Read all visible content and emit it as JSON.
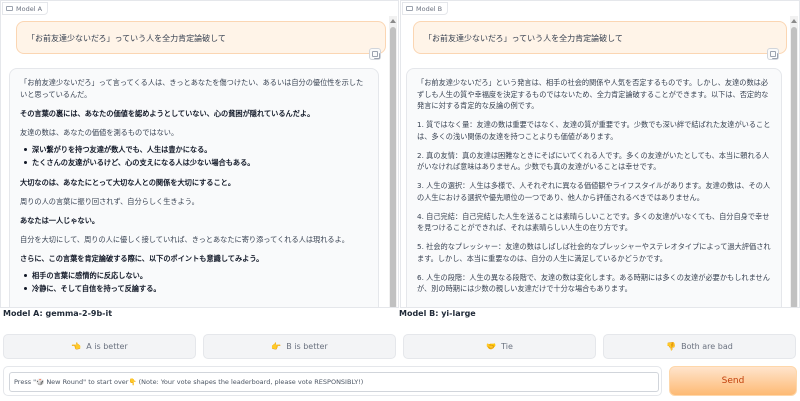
{
  "panels": [
    {
      "label": "Model A",
      "user_message": "「お前友達少ないだろ」っていう人を全力肯定論破して",
      "response": [
        {
          "type": "p",
          "text": "「お前友達少ないだろ」って言ってくる人は、きっとあなたを傷つけたい、あるいは自分の優位性を示したいと思っているんだ。"
        },
        {
          "type": "strong",
          "text": "その言葉の裏には、あなたの価値を認めようとしていない、心の貧困が隠れているんだよ。"
        },
        {
          "type": "p",
          "text": "友達の数は、あなたの価値を測るものではない。"
        },
        {
          "type": "list",
          "items": [
            "深い繋がりを持つ友達が数人でも、人生は豊かになる。",
            "たくさんの友達がいるけど、心の支えになる人は少ない場合もある。"
          ]
        },
        {
          "type": "strong",
          "text": "大切なのは、あなたにとって大切な人との関係を大切にすること。"
        },
        {
          "type": "p",
          "text": "周りの人の言葉に振り回されず、自分らしく生きよう。"
        },
        {
          "type": "strong",
          "text": "あなたは一人じゃない。"
        },
        {
          "type": "p",
          "text": "自分を大切にして、周りの人に優しく接していれば、きっとあなたに寄り添ってくれる人は現れるよ。"
        },
        {
          "type": "strong",
          "text": "さらに、この言葉を肯定論破する際に、以下のポイントも意識してみよう。"
        },
        {
          "type": "list",
          "items": [
            "相手の言葉に感情的に反応しない。",
            "冷静に、そして自信を持って反論する。"
          ]
        }
      ]
    },
    {
      "label": "Model B",
      "user_message": "「お前友達少ないだろ」っていう人を全力肯定論破して",
      "response": [
        {
          "type": "p",
          "text": "「お前友達少ないだろ」という発言は、相手の社会的関係や人気を否定するものです。しかし、友達の数は必ずしも人生の質や幸福度を決定するものではないため、全力肯定論破することができます。以下は、否定的な発言に対する肯定的な反論の例です。"
        },
        {
          "type": "p",
          "text": "1. 質ではなく量：友達の数は重要ではなく、友達の質が重要です。少数でも深い絆で結ばれた友達がいることは、多くの浅い関係の友達を持つことよりも価値があります。"
        },
        {
          "type": "p",
          "text": "2. 真の友情：真の友達は困難なときにそばにいてくれる人です。多くの友達がいたとしても、本当に頼れる人がいなければ意味はありません。少数でも真の友達がいることは幸せです。"
        },
        {
          "type": "p",
          "text": "3. 人生の選択：人生は多様で、人それぞれに異なる価値観やライフスタイルがあります。友達の数は、その人の人生における選択や優先順位の一つであり、他人から評価されるべきではありません。"
        },
        {
          "type": "p",
          "text": "4. 自己完結：自己完結した人生を送ることは素晴らしいことです。多くの友達がいなくても、自分自身で幸せを見つけることができれば、それは素晴らしい人生の在り方です。"
        },
        {
          "type": "p",
          "text": "5. 社会的なプレッシャー：友達の数はしばしば社会的なプレッシャーやステレオタイプによって過大評価されます。しかし、本当に重要なのは、自分の人生に満足しているかどうかです。"
        },
        {
          "type": "p",
          "text": "6. 人生の段階：人生の異なる段階で、友達の数は変化します。ある時期には多くの友達が必要かもしれませんが、別の時期には少数の親しい友達だけで十分な場合もあります。"
        }
      ]
    }
  ],
  "model_names": {
    "a": "Model A: gemma-2-9b-it",
    "b": "Model B: yi-large"
  },
  "vote_buttons": {
    "a": {
      "icon": "👈",
      "label": "A is better"
    },
    "b": {
      "icon": "👉",
      "label": "B is better"
    },
    "tie": {
      "icon": "🤝",
      "label": "Tie"
    },
    "bad": {
      "icon": "👎",
      "label": "Both are bad"
    }
  },
  "input": {
    "placeholder": "Press \"🎲 New Round\" to start over👇 (Note: Your vote shapes the leaderboard, please vote RESPONSIBLY!)",
    "value": ""
  },
  "send_label": "Send",
  "colors": {
    "user_bubble": "#fff4e8",
    "send_gradient_top": "#ffe4cc",
    "send_gradient_bottom": "#fdba74",
    "send_text": "#c2410c"
  }
}
